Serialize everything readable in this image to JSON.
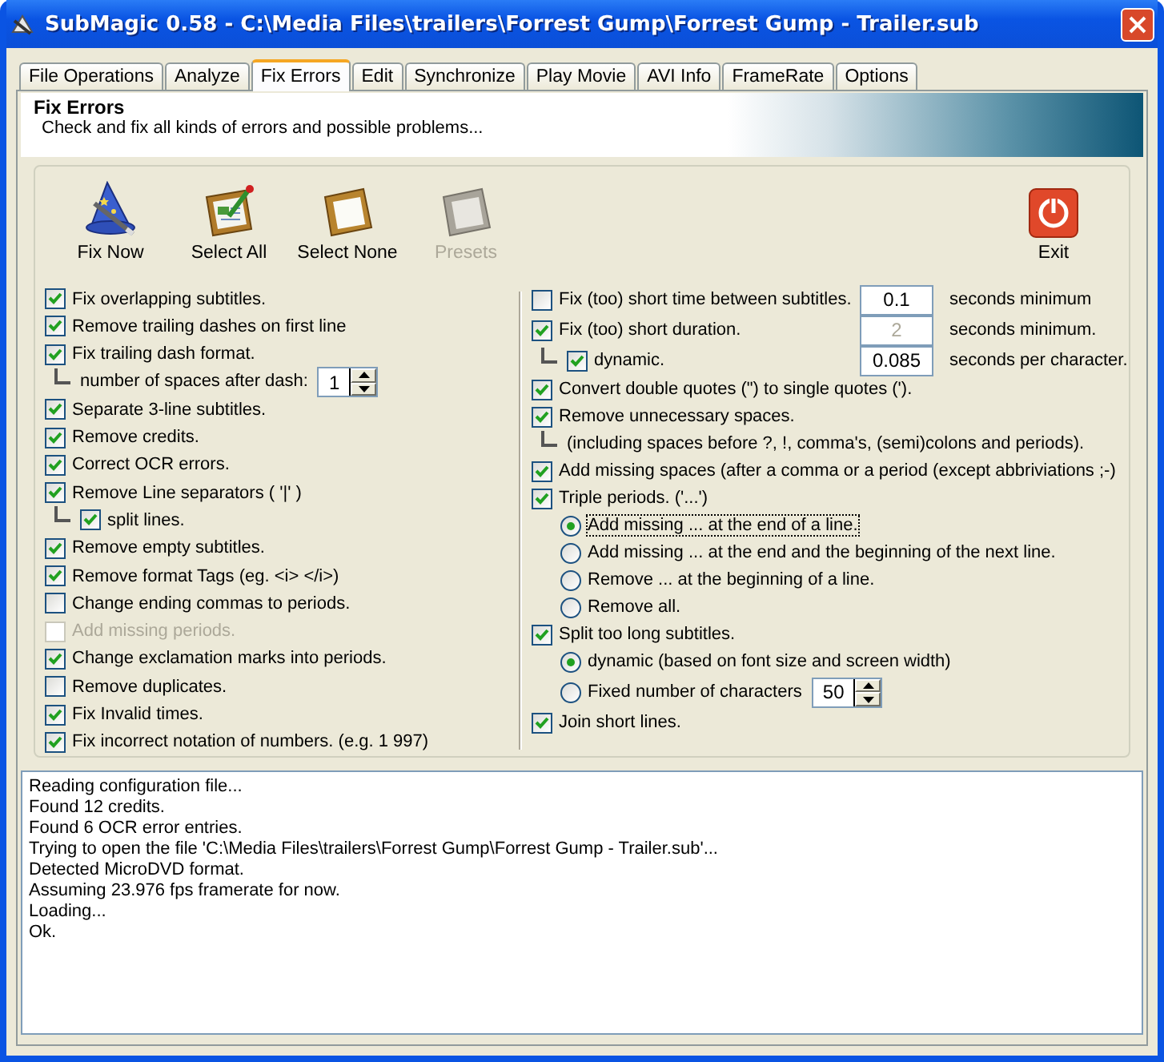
{
  "window": {
    "title": "SubMagic 0.58 - C:\\Media Files\\trailers\\Forrest Gump\\Forrest Gump - Trailer.sub"
  },
  "tabs": [
    {
      "label": "File Operations",
      "selected": false
    },
    {
      "label": "Analyze",
      "selected": false
    },
    {
      "label": "Fix Errors",
      "selected": true
    },
    {
      "label": "Edit",
      "selected": false
    },
    {
      "label": "Synchronize",
      "selected": false
    },
    {
      "label": "Play Movie",
      "selected": false
    },
    {
      "label": "AVI Info",
      "selected": false
    },
    {
      "label": "FrameRate",
      "selected": false
    },
    {
      "label": "Options",
      "selected": false
    }
  ],
  "header": {
    "title": "Fix Errors",
    "subtitle": "Check and fix all kinds of errors and possible problems..."
  },
  "toolbar": [
    {
      "kind": "wizard",
      "label": "Fix Now",
      "disabled": false
    },
    {
      "kind": "select_all",
      "label": "Select All",
      "disabled": false
    },
    {
      "kind": "select_none",
      "label": "Select None",
      "disabled": false
    },
    {
      "kind": "presets",
      "label": "Presets",
      "disabled": true
    },
    {
      "kind": "exit",
      "label": "Exit",
      "disabled": false
    }
  ],
  "left_options": [
    {
      "kind": "checkbox",
      "label": "Fix overlapping subtitles.",
      "checked": true,
      "disabled": false
    },
    {
      "kind": "checkbox",
      "label": "Remove trailing dashes on first line",
      "checked": true,
      "disabled": false
    },
    {
      "kind": "checkbox",
      "label": "Fix trailing dash format.",
      "checked": true,
      "disabled": false,
      "children": [
        {
          "kind": "spinner",
          "label": "number of spaces after dash:",
          "value": "1"
        }
      ]
    },
    {
      "kind": "checkbox",
      "label": "Separate 3-line subtitles.",
      "checked": true,
      "disabled": false
    },
    {
      "kind": "checkbox",
      "label": "Remove credits.",
      "checked": true,
      "disabled": false
    },
    {
      "kind": "checkbox",
      "label": "Correct OCR errors.",
      "checked": true,
      "disabled": false
    },
    {
      "kind": "checkbox",
      "label": "Remove Line separators ( '|' )",
      "checked": true,
      "disabled": false,
      "children": [
        {
          "kind": "checkbox",
          "label": "split lines.",
          "checked": true,
          "disabled": false
        }
      ]
    },
    {
      "kind": "checkbox",
      "label": "Remove empty subtitles.",
      "checked": true,
      "disabled": false
    },
    {
      "kind": "checkbox",
      "label": "Remove format Tags (eg. <i> </i>)",
      "checked": true,
      "disabled": false
    },
    {
      "kind": "checkbox",
      "label": "Change ending commas to periods.",
      "checked": false,
      "disabled": false
    },
    {
      "kind": "checkbox",
      "label": "Add missing periods.",
      "checked": false,
      "disabled": true
    },
    {
      "kind": "checkbox",
      "label": "Change exclamation marks into periods.",
      "checked": true,
      "disabled": false
    },
    {
      "kind": "checkbox",
      "label": "Remove duplicates.",
      "checked": false,
      "disabled": false
    },
    {
      "kind": "checkbox",
      "label": "Fix Invalid times.",
      "checked": true,
      "disabled": false
    },
    {
      "kind": "checkbox",
      "label": "Fix incorrect notation of numbers. (e.g. 1 997)",
      "checked": true,
      "disabled": false
    }
  ],
  "right_options": [
    {
      "kind": "checkbox",
      "label": "Fix (too) short time between subtitles.",
      "checked": false,
      "field": {
        "value": "0.1",
        "disabled": false
      },
      "unit": "seconds minimum"
    },
    {
      "kind": "checkbox",
      "label": "Fix (too) short duration.",
      "checked": true,
      "field": {
        "value": "2",
        "disabled": true
      },
      "unit": "seconds minimum.",
      "children": [
        {
          "kind": "checkbox",
          "label": "dynamic.",
          "checked": true,
          "field": {
            "value": "0.085",
            "disabled": false
          },
          "unit": "seconds per character."
        }
      ]
    },
    {
      "kind": "checkbox",
      "label": "Convert double quotes (\") to single quotes (').",
      "checked": true
    },
    {
      "kind": "checkbox",
      "label": "Remove unnecessary spaces.",
      "checked": true,
      "children": [
        {
          "kind": "note",
          "label": "(including spaces before ?, !, comma's, (semi)colons and periods)."
        }
      ]
    },
    {
      "kind": "checkbox",
      "label": "Add missing spaces (after a comma or a period (except abbriviations ;-)",
      "checked": true
    },
    {
      "kind": "checkbox",
      "label": "Triple periods. ('...')",
      "checked": true,
      "children": [
        {
          "kind": "radio",
          "label": "Add missing ... at the end of a line.",
          "selected": true,
          "focused": true
        },
        {
          "kind": "radio",
          "label": "Add missing ... at the end and the beginning of the next line.",
          "selected": false,
          "focused": false
        },
        {
          "kind": "radio",
          "label": "Remove ... at the beginning of a line.",
          "selected": false,
          "focused": false
        },
        {
          "kind": "radio",
          "label": "Remove all.",
          "selected": false,
          "focused": false
        }
      ]
    },
    {
      "kind": "checkbox",
      "label": "Split too long subtitles.",
      "checked": true,
      "children": [
        {
          "kind": "radio",
          "label": "dynamic (based on font size and screen width)",
          "selected": true,
          "focused": false
        },
        {
          "kind": "radio",
          "label": "Fixed number of characters",
          "selected": false,
          "focused": false,
          "spinner": "50"
        }
      ]
    },
    {
      "kind": "checkbox",
      "label": "Join short lines.",
      "checked": true
    }
  ],
  "log": [
    "Reading configuration file...",
    "Found 12 credits.",
    "Found 6 OCR error entries.",
    "Trying to open the file 'C:\\Media Files\\trailers\\Forrest Gump\\Forrest Gump - Trailer.sub'...",
    "Detected MicroDVD format.",
    "Assuming 23.976 fps framerate for now.",
    "Loading...",
    "Ok."
  ]
}
